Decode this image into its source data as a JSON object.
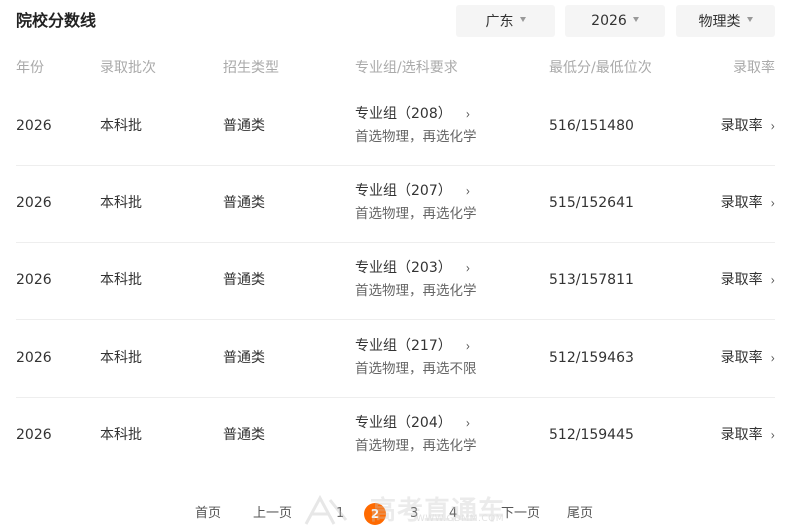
{
  "page": {
    "title": "院校分数线"
  },
  "filters": {
    "province": "广东",
    "year": "2026",
    "subject": "物理类"
  },
  "columns": {
    "year": "年份",
    "batch": "录取批次",
    "type": "招生类型",
    "group": "专业组/选科要求",
    "score": "最低分/最低位次",
    "rate": "录取率"
  },
  "rows": [
    {
      "year": "2026",
      "batch": "本科批",
      "type": "普通类",
      "group": "专业组（208）",
      "requirement": "首选物理，再选化学",
      "score": "516/151480",
      "rate": "录取率"
    },
    {
      "year": "2026",
      "batch": "本科批",
      "type": "普通类",
      "group": "专业组（207）",
      "requirement": "首选物理，再选化学",
      "score": "515/152641",
      "rate": "录取率"
    },
    {
      "year": "2026",
      "batch": "本科批",
      "type": "普通类",
      "group": "专业组（203）",
      "requirement": "首选物理，再选化学",
      "score": "513/157811",
      "rate": "录取率"
    },
    {
      "year": "2026",
      "batch": "本科批",
      "type": "普通类",
      "group": "专业组（217）",
      "requirement": "首选物理，再选不限",
      "score": "512/159463",
      "rate": "录取率"
    },
    {
      "year": "2026",
      "batch": "本科批",
      "type": "普通类",
      "group": "专业组（204）",
      "requirement": "首选物理，再选化学",
      "score": "512/159445",
      "rate": "录取率"
    }
  ],
  "pagination": {
    "first": "首页",
    "prev": "上一页",
    "pages": [
      "1",
      "2",
      "3",
      "4"
    ],
    "current": "2",
    "next": "下一页",
    "last": "尾页"
  },
  "watermark": {
    "text": "高考直通车",
    "url": "WWW.GDMM.COM"
  },
  "colors": {
    "accent": "#ff6a00",
    "header_text": "#aaaaaa",
    "filter_bg": "#f5f5f5"
  }
}
